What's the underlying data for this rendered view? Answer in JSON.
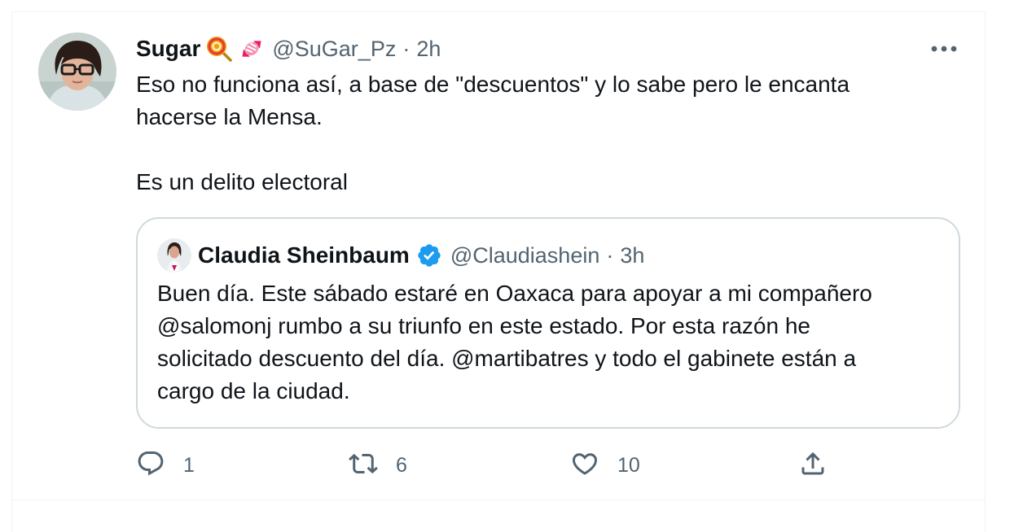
{
  "tweet": {
    "author": {
      "display_name": "Sugar",
      "handle": "@SuGar_Pz",
      "time": "2h"
    },
    "separator": "·",
    "text_lines": [
      "Eso no funciona así, a base de \"descuentos\" y lo sabe pero le encanta",
      "hacerse la Mensa.",
      "",
      "Es un delito electoral"
    ],
    "quoted": {
      "display_name": "Claudia Sheinbaum",
      "handle": "@Claudiashein",
      "time": "3h",
      "separator": "·",
      "text_lines": [
        "Buen día. Este sábado estaré en Oaxaca para apoyar a mi compañero",
        "@salomonj rumbo a su triunfo en este estado. Por esta razón he",
        "solicitado descuento del día. @martibatres y todo el gabinete están a",
        "cargo de la ciudad."
      ]
    },
    "actions": {
      "replies": "1",
      "retweets": "6",
      "likes": "10"
    }
  },
  "icons": {
    "name_emojis": [
      "lollipop-icon",
      "candy-icon"
    ],
    "verified": "verified-badge-icon",
    "more": "more-options-icon",
    "reply": "reply-icon",
    "retweet": "retweet-icon",
    "like": "heart-icon",
    "share": "share-icon"
  },
  "colors": {
    "text": "#0f1419",
    "secondary": "#536471",
    "border": "#cfd9de",
    "divider": "#eff3f4",
    "verified": "#1d9bf0"
  }
}
